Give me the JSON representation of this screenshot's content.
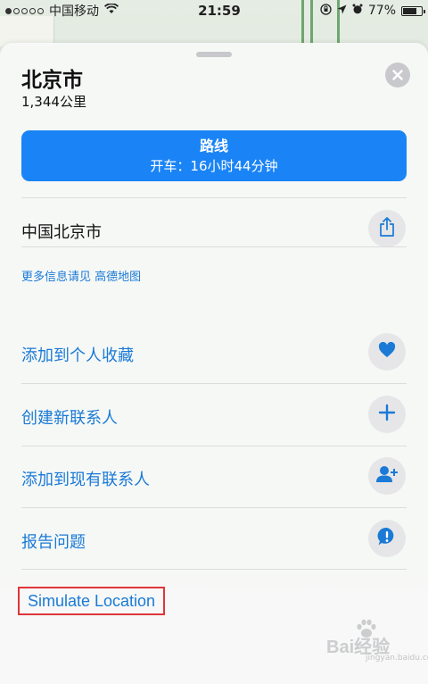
{
  "status_bar": {
    "carrier": "中国移动",
    "time": "21:59",
    "battery_percent": "77%",
    "battery_level": 0.77
  },
  "place": {
    "title": "北京市",
    "distance": "1,344公里"
  },
  "route_button": {
    "title": "路线",
    "subtitle": "开车：16小时44分钟"
  },
  "address": "中国北京市",
  "more_info": "更多信息请见 高德地图",
  "actions": [
    {
      "label": "添加到个人收藏",
      "icon": "heart-icon"
    },
    {
      "label": "创建新联系人",
      "icon": "plus-icon"
    },
    {
      "label": "添加到现有联系人",
      "icon": "add-contact-icon"
    },
    {
      "label": "报告问题",
      "icon": "exclamation-bubble-icon"
    }
  ],
  "simulate_location": "Simulate Location",
  "watermark": {
    "text": "Bai经验",
    "sub": "jingyan.baidu.com"
  },
  "colors": {
    "accent": "#1a84f6",
    "link": "#1a7ad6",
    "highlight_box": "#e0353b"
  }
}
